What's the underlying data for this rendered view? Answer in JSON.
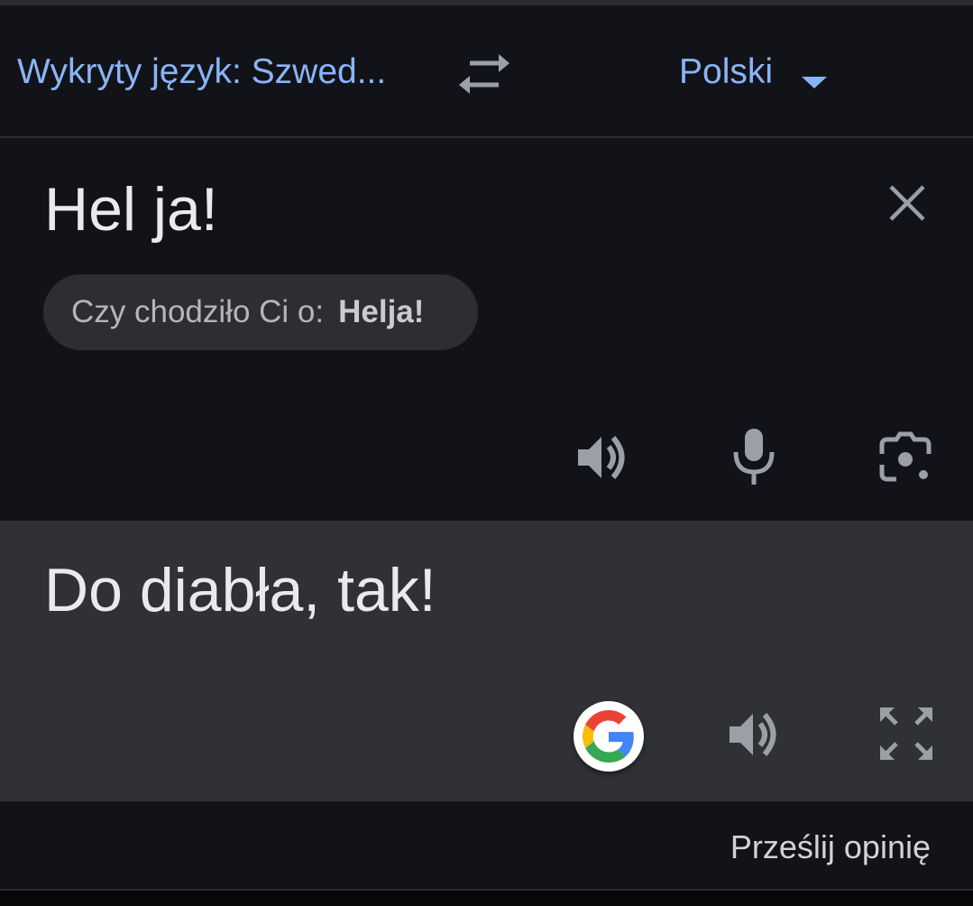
{
  "language_bar": {
    "source_language": "Wykryty język: Szwed...",
    "target_language": "Polski"
  },
  "input": {
    "text": "Hel ja!",
    "suggestion_prefix": "Czy chodziło Ci o:",
    "suggestion_term": "Helja!"
  },
  "output": {
    "text": "Do diabła, tak!"
  },
  "footer": {
    "feedback_label": "Prześlij opinię"
  },
  "colors": {
    "background": "#121318",
    "output_background": "#303134",
    "accent_blue": "#8ab4f8",
    "icon_gray": "#9aa0a6"
  }
}
